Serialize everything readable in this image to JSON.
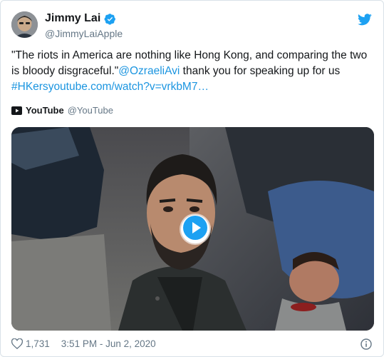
{
  "author": {
    "name": "Jimmy Lai",
    "handle": "@JimmyLaiApple",
    "verified": true
  },
  "tweet": {
    "text_main": "\"The riots in America are nothing like Hong Kong, and comparing the two is bloody disgraceful.\"",
    "mention": "@OzraeliAvi",
    "text_after_mention": " thank you for speaking up for us",
    "hashtag": "#HKers",
    "link": "youtube.com/watch?v=vrkbM7…"
  },
  "card_source": {
    "name": "YouTube",
    "handle": "@YouTube"
  },
  "footer": {
    "like_count": "1,731",
    "timestamp": "3:51 PM - Jun 2, 2020"
  },
  "colors": {
    "link": "#1b95e0",
    "verified": "#1da1f2",
    "twitter_brand": "#1da1f2",
    "youtube_red": "#ff0000",
    "muted": "#657786"
  },
  "icons": [
    "verified-badge-icon",
    "twitter-bird-icon",
    "youtube-logo-icon",
    "play-icon",
    "heart-icon",
    "info-icon"
  ]
}
